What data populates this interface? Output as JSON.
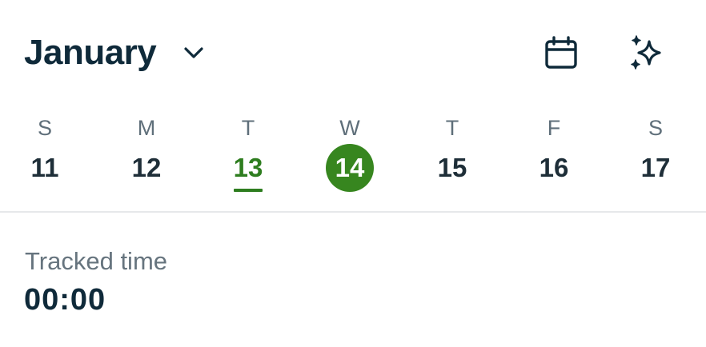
{
  "header": {
    "month": "January",
    "month_dropdown_icon": "chevron-down-icon",
    "calendar_icon": "calendar-icon",
    "ai_icon": "sparkles-icon"
  },
  "week": {
    "days": [
      {
        "letter": "S",
        "number": "11",
        "state": "normal"
      },
      {
        "letter": "M",
        "number": "12",
        "state": "normal"
      },
      {
        "letter": "T",
        "number": "13",
        "state": "today"
      },
      {
        "letter": "W",
        "number": "14",
        "state": "selected"
      },
      {
        "letter": "T",
        "number": "15",
        "state": "normal"
      },
      {
        "letter": "F",
        "number": "16",
        "state": "normal"
      },
      {
        "letter": "S",
        "number": "17",
        "state": "normal"
      }
    ]
  },
  "tracked": {
    "label": "Tracked time",
    "value": "00:00"
  },
  "colors": {
    "accent": "#37861f",
    "text_primary": "#0f2a3a",
    "text_secondary": "#66747e"
  }
}
